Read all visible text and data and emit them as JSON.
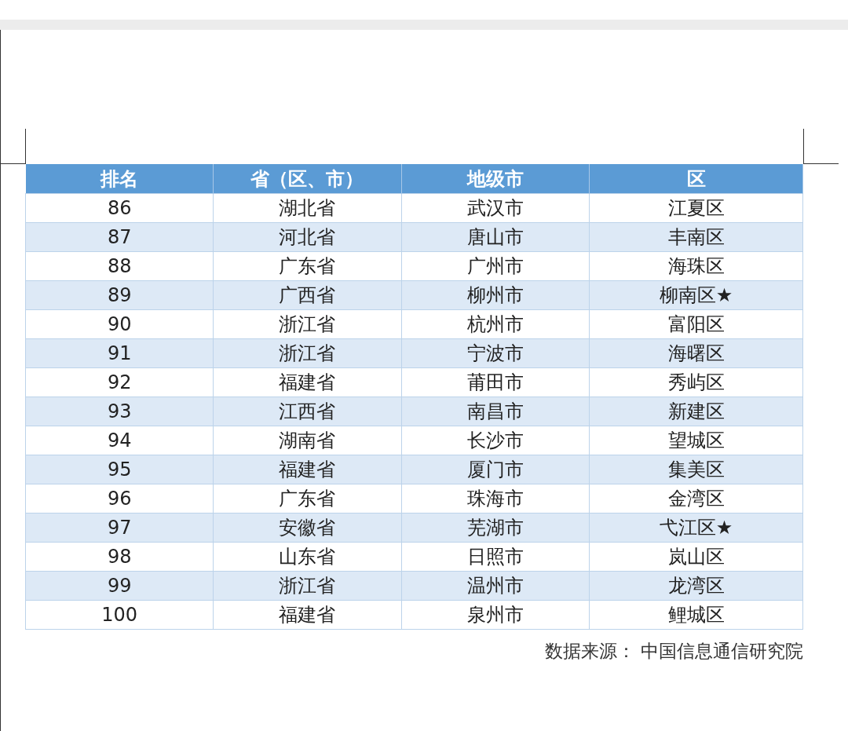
{
  "table": {
    "columns": [
      "排名",
      "省（区、市）",
      "地级市",
      "区"
    ],
    "rows": [
      [
        "86",
        "湖北省",
        "武汉市",
        "江夏区"
      ],
      [
        "87",
        "河北省",
        "唐山市",
        "丰南区"
      ],
      [
        "88",
        "广东省",
        "广州市",
        "海珠区"
      ],
      [
        "89",
        "广西省",
        "柳州市",
        "柳南区★"
      ],
      [
        "90",
        "浙江省",
        "杭州市",
        "富阳区"
      ],
      [
        "91",
        "浙江省",
        "宁波市",
        "海曙区"
      ],
      [
        "92",
        "福建省",
        "莆田市",
        "秀屿区"
      ],
      [
        "93",
        "江西省",
        "南昌市",
        "新建区"
      ],
      [
        "94",
        "湖南省",
        "长沙市",
        "望城区"
      ],
      [
        "95",
        "福建省",
        "厦门市",
        "集美区"
      ],
      [
        "96",
        "广东省",
        "珠海市",
        "金湾区"
      ],
      [
        "97",
        "安徽省",
        "芜湖市",
        "弋江区★"
      ],
      [
        "98",
        "山东省",
        "日照市",
        "岚山区"
      ],
      [
        "99",
        "浙江省",
        "温州市",
        "龙湾区"
      ],
      [
        "100",
        "福建省",
        "泉州市",
        "鲤城区"
      ]
    ]
  },
  "source_note": "数据来源： 中国信息通信研究院"
}
